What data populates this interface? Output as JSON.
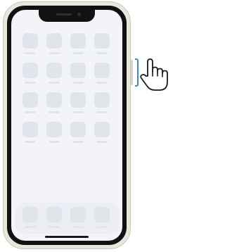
{
  "device": {
    "frame_color": "#e9e7dd",
    "bezel_color": "#111111",
    "screen_color": "#f3f4f8",
    "app_placeholder_color": "#e1e4ea",
    "side_button_highlight_color": "#3b87d9"
  },
  "home_screen": {
    "app_rows": 4,
    "app_columns": 4,
    "dock_apps": 4
  },
  "icons": {
    "pointer": "hand-pointer-icon",
    "press_indicator": "button-press-bracket"
  }
}
